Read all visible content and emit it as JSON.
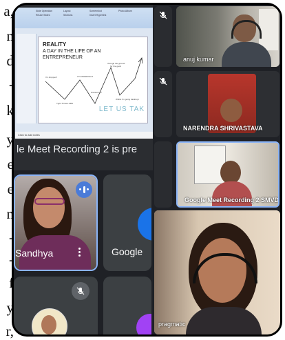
{
  "document_margin_letters": [
    "a,",
    "n",
    "d",
    "-",
    "k",
    "y",
    "e",
    "e",
    "n",
    "-",
    "-",
    "f",
    "y",
    "r,"
  ],
  "shared_screen": {
    "slide_title": "REALITY",
    "slide_subtitle": "A DAY IN THE LIFE OF AN ENTREPRENEUR",
    "slide_cta": "LET US TAK",
    "graph_labels": [
      "I'm dropped!",
      "IT'S WORKING!!!",
      "through the ground",
      "for the good",
      "Tight Thrown ABS",
      "dressed up!",
      "Whilst I'm going bankrupt"
    ],
    "notes_placeholder": "Click to add notes",
    "ribbon_items": [
      "Slide Operation",
      "Reuse Slides",
      "Layout",
      "Sections",
      "Screenshot",
      "Insert Hyperlink",
      "Photo Album"
    ],
    "presenting_banner": "le Meet Recording 2  is pre"
  },
  "participants": [
    {
      "name": "anuj kumar",
      "muted": false
    },
    {
      "name": "NARENDRA SHRIVASTAVA",
      "muted": true
    },
    {
      "name": "Google Meet Recording 2 SMVDU",
      "muted": false
    },
    {
      "name": "pragmatic",
      "muted": false
    },
    {
      "name": "Sandhya",
      "muted": false,
      "speaking": true
    },
    {
      "name": "Google",
      "muted": false
    }
  ],
  "colors": {
    "meet_bg": "#1f2126",
    "tile_bg": "#3c4043",
    "active_speaker_border": "#8ab4f8",
    "speaking_badge": "#4a7bd8",
    "google_avatar": "#1a73e8",
    "purple_avatar": "#a142f4"
  }
}
